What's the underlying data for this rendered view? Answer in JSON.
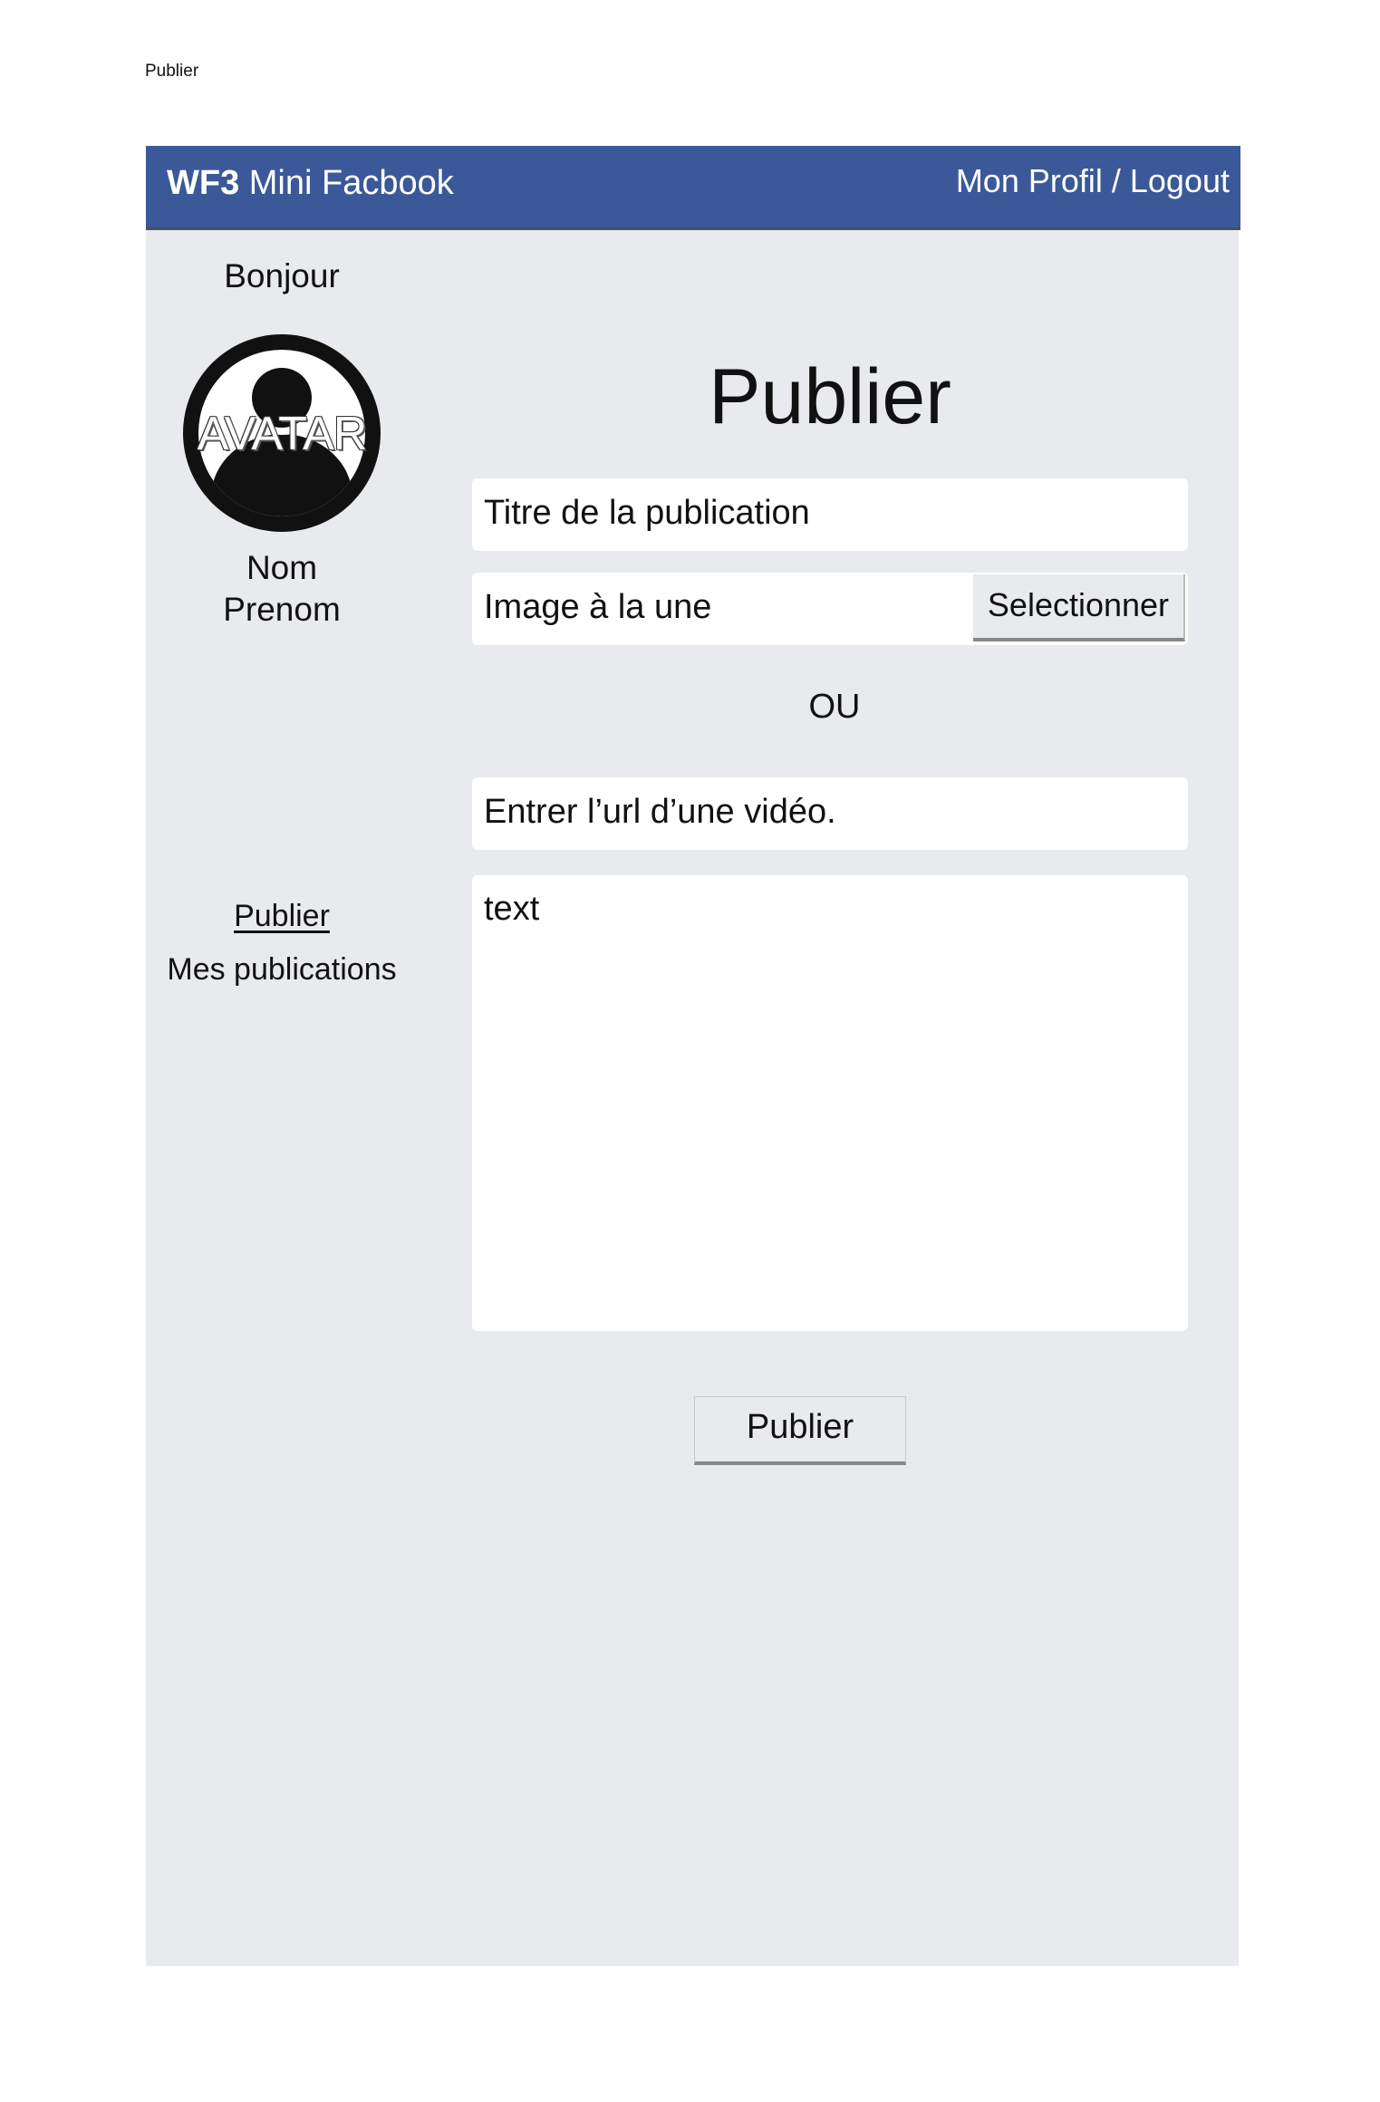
{
  "page_label": "Publier",
  "topbar": {
    "brand_bold": "WF3",
    "brand_rest": "Mini Facbook",
    "profile_link": "Mon Profil",
    "separator": " / ",
    "logout_link": "Logout",
    "color": "#3b5998"
  },
  "sidebar": {
    "greeting": "Bonjour",
    "avatar_label": "AVATAR",
    "last_name": "Nom",
    "first_name": "Prenom",
    "nav_publish": "Publier",
    "nav_my_posts": "Mes publications"
  },
  "form": {
    "heading": "Publier",
    "title_placeholder": "Titre de la publication",
    "image_placeholder": "Image à la une",
    "select_button": "Selectionner",
    "or_text": "OU",
    "video_placeholder": "Entrer l’url d’une vidéo.",
    "text_placeholder": "text",
    "submit_button": "Publier"
  }
}
